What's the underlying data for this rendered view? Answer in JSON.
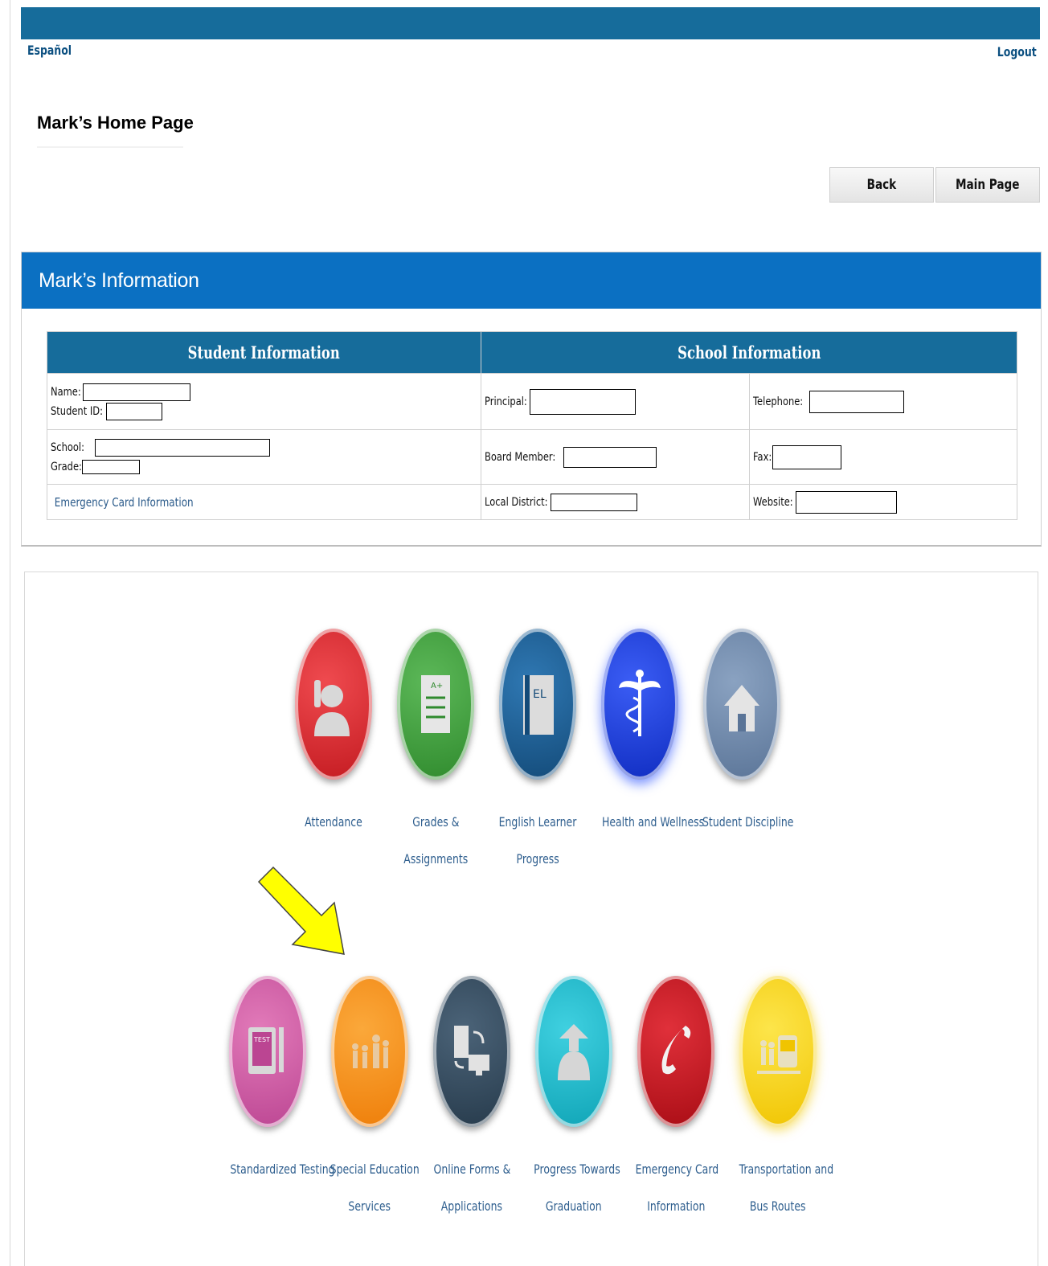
{
  "header": {
    "language_link": "Español",
    "logout_link": "Logout"
  },
  "page": {
    "title": "Mark’s Home Page"
  },
  "buttons": {
    "back": "Back",
    "main_page": "Main Page"
  },
  "info_panel": {
    "title": "Mark’s Information",
    "student_header": "Student Information",
    "school_header": "School Information",
    "fields": {
      "name": "Name:",
      "student_id": "Student ID:",
      "school": "School:",
      "grade": "Grade:",
      "emergency_link": "Emergency Card Information",
      "principal": "Principal:",
      "board_member": "Board Member:",
      "local_district": "Local District:",
      "telephone": "Telephone:",
      "fax": "Fax:",
      "website": "Website:"
    }
  },
  "tiles_row1": [
    {
      "label_line1": "Attendance",
      "label_line2": "",
      "icon": "attendance-icon",
      "color": "#d8262c"
    },
    {
      "label_line1": "Grades &",
      "label_line2": "Assignments",
      "icon": "grades-icon",
      "color": "#3f9a3c"
    },
    {
      "label_line1": "English Learner",
      "label_line2": "Progress",
      "icon": "english-learner-book-icon",
      "color": "#1c5e93"
    },
    {
      "label_line1": "Health and Wellness",
      "label_line2": "",
      "icon": "caduceus-icon",
      "color": "#1638d8"
    },
    {
      "label_line1": "Student Discipline",
      "label_line2": "",
      "icon": "house-icon",
      "color": "#6d87a8"
    }
  ],
  "tiles_row2": [
    {
      "label_line1": "Standardized Testing",
      "label_line2": "",
      "icon": "test-tablet-icon",
      "color": "#d460a8"
    },
    {
      "label_line1": "Special Education",
      "label_line2": "Services",
      "icon": "family-icon",
      "color": "#f7900f"
    },
    {
      "label_line1": "Online Forms &",
      "label_line2": "Applications",
      "icon": "computer-forms-icon",
      "color": "#334a5e"
    },
    {
      "label_line1": "Progress Towards",
      "label_line2": "Graduation",
      "icon": "graduate-icon",
      "color": "#16b7c9"
    },
    {
      "label_line1": "Emergency Card",
      "label_line2": "Information",
      "icon": "phone-icon",
      "color": "#c2121b"
    },
    {
      "label_line1": "Transportation and",
      "label_line2": "Bus Routes",
      "icon": "bus-icon",
      "color": "#f5d20d"
    }
  ],
  "annotation": {
    "arrow_color": "#ffff00",
    "arrow_icon": "yellow-arrow-pointer"
  }
}
